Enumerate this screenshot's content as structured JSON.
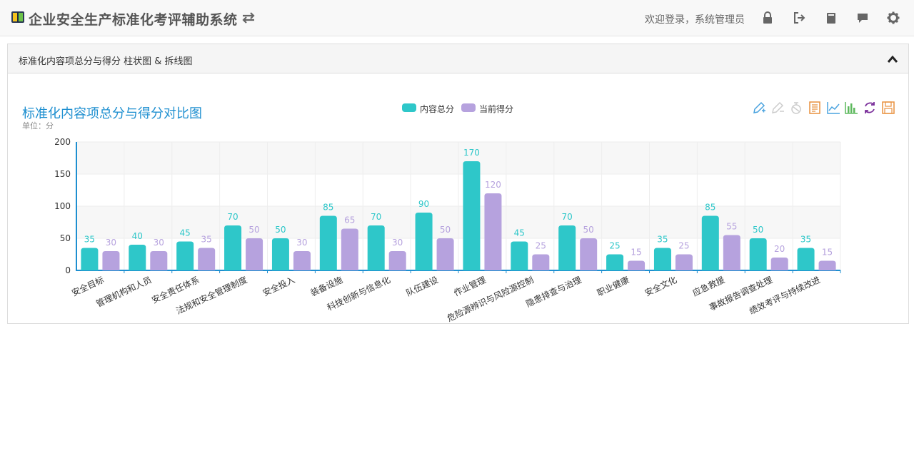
{
  "header": {
    "app_title": "企业安全生产标准化考评辅助系统",
    "welcome_text": "欢迎登录，系统管理员",
    "icons": [
      "book-logo-icon",
      "swap-arrows-icon",
      "lock-icon",
      "logout-icon",
      "manual-icon",
      "message-icon",
      "settings-icon"
    ]
  },
  "panel": {
    "title": "标准化内容项总分与得分 柱状图 & 拆线图"
  },
  "chart_data": {
    "type": "bar",
    "title": "标准化内容项总分与得分对比图",
    "subtitle": "单位：分",
    "categories": [
      "安全目标",
      "管理机构和人员",
      "安全责任体系",
      "法规和安全管理制度",
      "安全投入",
      "装备设施",
      "科技创新与信息化",
      "队伍建设",
      "作业管理",
      "危险源辨识与风险源控制",
      "隐患排查与治理",
      "职业健康",
      "安全文化",
      "应急救援",
      "事故报告调查处理",
      "绩效考评与持续改进"
    ],
    "series": [
      {
        "name": "内容总分",
        "color": "#2ec7c9",
        "values": [
          35,
          40,
          45,
          70,
          50,
          85,
          70,
          90,
          170,
          45,
          70,
          25,
          35,
          85,
          50,
          35
        ]
      },
      {
        "name": "当前得分",
        "color": "#b6a2de",
        "values": [
          30,
          30,
          35,
          50,
          30,
          65,
          30,
          50,
          120,
          25,
          50,
          15,
          25,
          55,
          20,
          15
        ]
      }
    ],
    "ylim": [
      0,
      200
    ],
    "yticks": [
      0,
      50,
      100,
      150,
      200
    ],
    "legend_position": "top-center",
    "grid": true,
    "toolbox_icons": [
      "mark-icon",
      "mark-undo-icon",
      "mark-clear-icon",
      "data-view-icon",
      "line-chart-icon",
      "bar-chart-icon",
      "restore-icon",
      "save-image-icon"
    ]
  }
}
